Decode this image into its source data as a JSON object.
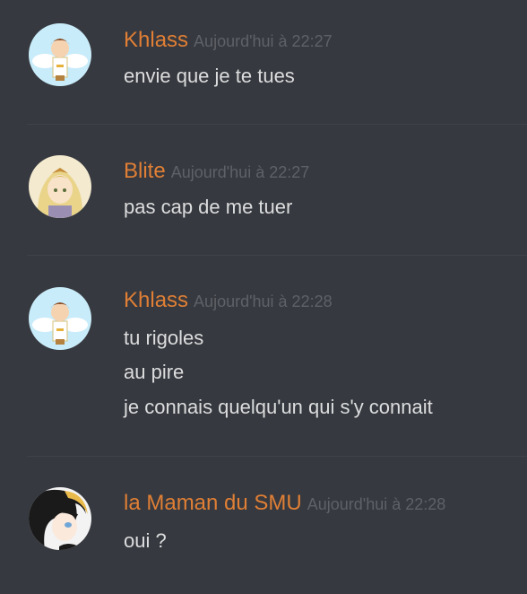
{
  "theme": {
    "background": "#36393f",
    "username_color": "#e07f35",
    "timestamp_color": "#5f6168",
    "text_color": "#dcddde",
    "divider_color": "#3f4248"
  },
  "messages": [
    {
      "avatar": "pit-character-avatar",
      "username": "Khlass",
      "timestamp": "Aujourd'hui à 22:27",
      "lines": [
        "envie que je te tues"
      ]
    },
    {
      "avatar": "zelda-character-avatar",
      "username": "Blite",
      "timestamp": "Aujourd'hui à 22:27",
      "lines": [
        "pas cap de me tuer"
      ]
    },
    {
      "avatar": "pit-character-avatar",
      "username": "Khlass",
      "timestamp": "Aujourd'hui à 22:28",
      "lines": [
        "tu rigoles",
        "au pire",
        "je connais quelqu'un qui s'y connait"
      ]
    },
    {
      "avatar": "anime-character-avatar",
      "username": "la Maman du SMU",
      "timestamp": "Aujourd'hui à 22:28",
      "lines": [
        "oui ?"
      ]
    }
  ]
}
